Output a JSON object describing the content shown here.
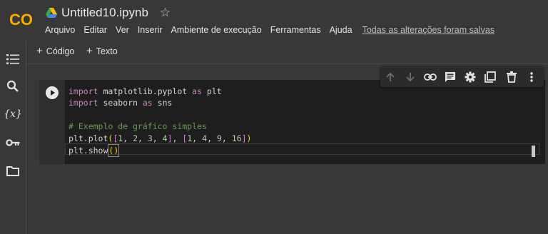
{
  "header": {
    "logo": "CO",
    "title": "Untitled10.ipynb",
    "star_icon": "star-icon",
    "menu": [
      "Arquivo",
      "Editar",
      "Ver",
      "Inserir",
      "Ambiente de execução",
      "Ferramentas",
      "Ajuda"
    ],
    "save_status": "Todas as alterações foram salvas"
  },
  "toolbar": {
    "add_code": "Código",
    "add_text": "Texto"
  },
  "sidebar": {
    "items": [
      "toc-icon",
      "search-icon",
      "variables-icon",
      "key-icon",
      "folder-icon"
    ],
    "variables_glyph": "{x}"
  },
  "cell_toolbar": {
    "icons": [
      "move-up-icon",
      "move-down-icon",
      "link-icon",
      "comment-icon",
      "settings-icon",
      "mirror-cell-icon",
      "delete-icon",
      "more-icon"
    ]
  },
  "code_cell": {
    "lines": [
      {
        "parts": [
          {
            "t": "import",
            "c": "kw"
          },
          {
            "t": " matplotlib.pyplot "
          },
          {
            "t": "as",
            "c": "kw"
          },
          {
            "t": " plt"
          }
        ]
      },
      {
        "parts": [
          {
            "t": "import",
            "c": "kw"
          },
          {
            "t": " seaborn "
          },
          {
            "t": "as",
            "c": "kw"
          },
          {
            "t": " sns"
          }
        ]
      },
      {
        "parts": [
          {
            "t": ""
          }
        ]
      },
      {
        "parts": [
          {
            "t": "# Exemplo de gráfico simples",
            "c": "cm"
          }
        ]
      },
      {
        "parts": [
          {
            "t": "plt.plot"
          },
          {
            "t": "(",
            "c": "br1"
          },
          {
            "t": "[",
            "c": "br2"
          },
          {
            "t": "1",
            "c": "num"
          },
          {
            "t": ", "
          },
          {
            "t": "2",
            "c": "num"
          },
          {
            "t": ", "
          },
          {
            "t": "3",
            "c": "num"
          },
          {
            "t": ", "
          },
          {
            "t": "4",
            "c": "num"
          },
          {
            "t": "]",
            "c": "br2"
          },
          {
            "t": ", "
          },
          {
            "t": "[",
            "c": "br2"
          },
          {
            "t": "1",
            "c": "num"
          },
          {
            "t": ", "
          },
          {
            "t": "4",
            "c": "num"
          },
          {
            "t": ", "
          },
          {
            "t": "9",
            "c": "num"
          },
          {
            "t": ", "
          },
          {
            "t": "16",
            "c": "num"
          },
          {
            "t": "]",
            "c": "br2"
          },
          {
            "t": ")",
            "c": "br1"
          }
        ]
      },
      {
        "parts": [
          {
            "t": "plt.show"
          },
          {
            "t": "()",
            "c": "br1",
            "box": true
          }
        ]
      }
    ]
  }
}
